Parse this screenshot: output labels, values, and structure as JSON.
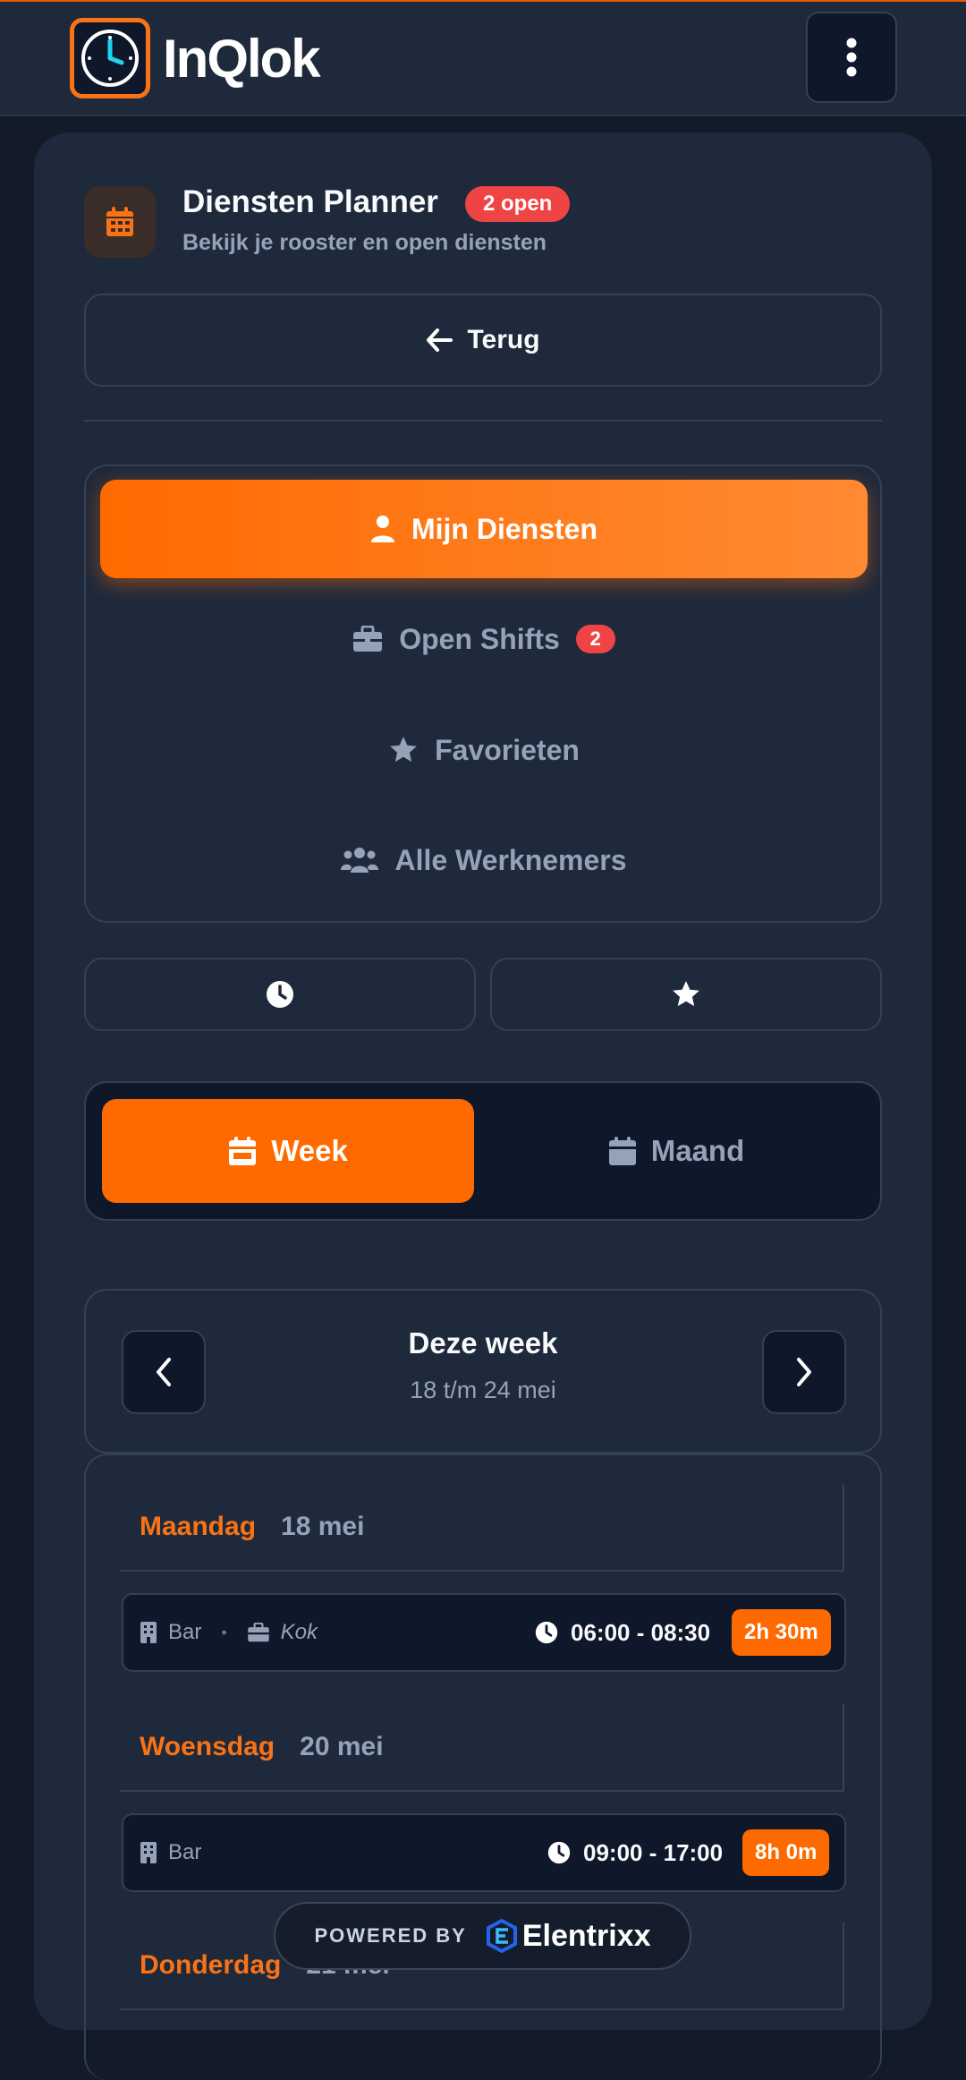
{
  "app": {
    "logo_text": "InQlok"
  },
  "header": {
    "title": "Diensten Planner",
    "open_badge": "2 open",
    "subtitle": "Bekijk je rooster en open diensten",
    "back_label": "Terug"
  },
  "nav": {
    "items": [
      {
        "label": "Mijn Diensten",
        "icon": "user-icon",
        "active": true
      },
      {
        "label": "Open Shifts",
        "icon": "briefcase-icon",
        "badge": "2"
      },
      {
        "label": "Favorieten",
        "icon": "star-icon"
      },
      {
        "label": "Alle Werknemers",
        "icon": "users-icon"
      }
    ]
  },
  "quick": {
    "left_icon": "clock-icon",
    "right_icon": "star-icon"
  },
  "view_toggle": {
    "week_label": "Week",
    "month_label": "Maand",
    "selected": "Week"
  },
  "week": {
    "title": "Deze week",
    "range": "18 t/m 24 mei"
  },
  "days": [
    {
      "name": "Maandag",
      "date": "18 mei",
      "shift": {
        "location": "Bar",
        "role": "Kok",
        "time": "06:00 - 08:30",
        "duration": "2h 30m"
      }
    },
    {
      "name": "Woensdag",
      "date": "20 mei",
      "shift": {
        "location": "Bar",
        "time": "09:00 - 17:00",
        "duration": "8h 0m"
      }
    },
    {
      "name": "Donderdag",
      "date": "21 mei"
    }
  ],
  "footer": {
    "powered_by": "POWERED BY",
    "brand": "Elentrixx"
  },
  "colors": {
    "accent": "#ff6a00",
    "badge_red": "#ef4444",
    "bg": "#1e293b"
  }
}
